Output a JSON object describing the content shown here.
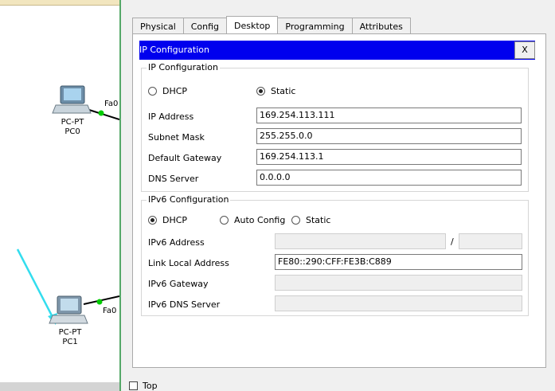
{
  "canvas": {
    "pc0": {
      "type": "PC-PT",
      "name": "PC0",
      "port": "Fa0"
    },
    "pc1": {
      "type": "PC-PT",
      "name": "PC1",
      "port": "Fa0"
    }
  },
  "tabs": [
    "Physical",
    "Config",
    "Desktop",
    "Programming",
    "Attributes"
  ],
  "active_tab": "Desktop",
  "ip_config": {
    "bar_title": "IP Configuration",
    "close_label": "X",
    "ipv4": {
      "legend": "IP Configuration",
      "dhcp_label": "DHCP",
      "static_label": "Static",
      "mode": "Static",
      "ip_address_label": "IP Address",
      "ip_address": "169.254.113.111",
      "subnet_mask_label": "Subnet Mask",
      "subnet_mask": "255.255.0.0",
      "default_gateway_label": "Default Gateway",
      "default_gateway": "169.254.113.1",
      "dns_server_label": "DNS Server",
      "dns_server": "0.0.0.0"
    },
    "ipv6": {
      "legend": "IPv6 Configuration",
      "dhcp_label": "DHCP",
      "auto_label": "Auto Config",
      "static_label": "Static",
      "mode": "DHCP",
      "address_label": "IPv6 Address",
      "address": "",
      "prefix_separator": "/",
      "prefix": "",
      "link_local_label": "Link Local Address",
      "link_local": "FE80::290:CFF:FE3B:C889",
      "gateway_label": "IPv6 Gateway",
      "gateway": "",
      "dns_label": "IPv6 DNS Server",
      "dns": ""
    }
  },
  "top_checkbox_label": "Top",
  "colors": {
    "accent_bar": "#0000ee",
    "link_green": "#00cc00",
    "annotation_arrow": "#33ddee"
  }
}
